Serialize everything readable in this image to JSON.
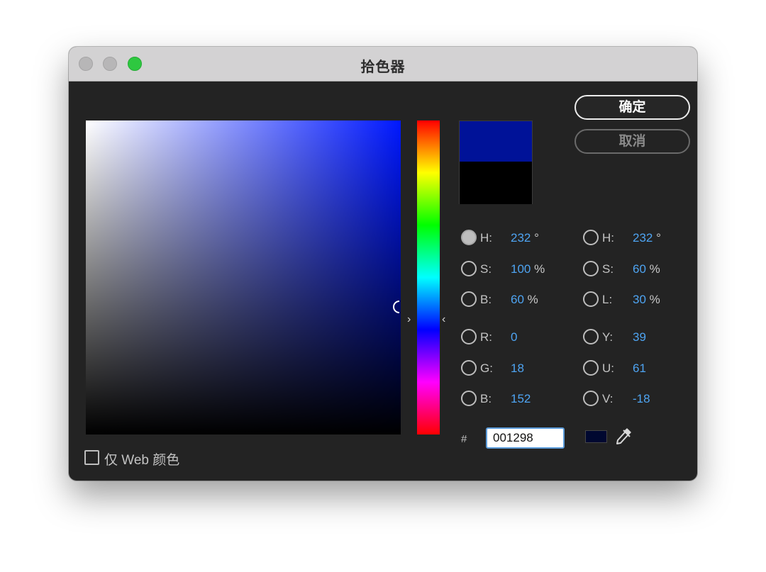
{
  "window": {
    "title": "拾色器"
  },
  "buttons": {
    "ok": "确定",
    "cancel": "取消"
  },
  "colors": {
    "current_color": "#001298",
    "previous_color": "#000000",
    "hue_base": "#0018ff",
    "accent_value": "#4ea4f2"
  },
  "hsb": {
    "h": {
      "label": "H:",
      "value": "232",
      "unit": "°",
      "selected": true
    },
    "s": {
      "label": "S:",
      "value": "100",
      "unit": "%"
    },
    "b": {
      "label": "B:",
      "value": "60",
      "unit": "%"
    }
  },
  "rgb": {
    "r": {
      "label": "R:",
      "value": "0"
    },
    "g": {
      "label": "G:",
      "value": "18"
    },
    "b": {
      "label": "B:",
      "value": "152"
    }
  },
  "hsl": {
    "h": {
      "label": "H:",
      "value": "232",
      "unit": "°"
    },
    "s": {
      "label": "S:",
      "value": "60",
      "unit": "%"
    },
    "l": {
      "label": "L:",
      "value": "30",
      "unit": "%"
    }
  },
  "yuv": {
    "y": {
      "label": "Y:",
      "value": "39"
    },
    "u": {
      "label": "U:",
      "value": "61"
    },
    "v": {
      "label": "V:",
      "value": "-18"
    }
  },
  "hex": {
    "prefix": "#",
    "value": "001298"
  },
  "web_only": {
    "label": "仅 Web 颜色",
    "checked": false
  },
  "icons": {
    "eyedropper": "eyedropper-icon",
    "hue_arrows": [
      "chevron-right-icon",
      "chevron-left-icon"
    ]
  }
}
